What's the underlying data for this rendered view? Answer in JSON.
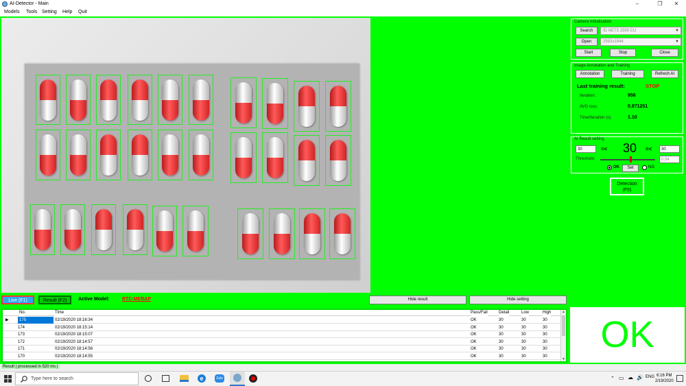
{
  "window": {
    "title": "AI-Detector - Main"
  },
  "menu": [
    "Models",
    "Tools",
    "Setting",
    "Help",
    "Quit"
  ],
  "camera_init": {
    "title": "Camera Initialization",
    "search_label": "Search",
    "camera_value": "ID NET3 1500 CU",
    "open_label": "Open",
    "resolution_value": "2592x1944",
    "start_label": "Start",
    "stop_label": "Stop",
    "close_label": "Close"
  },
  "training": {
    "title": "Image Annotation and Training",
    "annotation_label": "Annotation",
    "training_label": "Training",
    "refresh_label": "Refresh AI",
    "last_result_label": "Last training result:",
    "last_result_value": "STOP",
    "iteration_label": "Iteration:",
    "iteration_value": "956",
    "avg_loss_label": "AVG loss:",
    "avg_loss_value": "0.871251",
    "time_label": "Time/Iteration (s):",
    "time_value": "1.10"
  },
  "ai_result": {
    "title": "AI Result setting",
    "low_value": "30",
    "op_left": "=<",
    "count_value": "30",
    "op_right": "=<",
    "high_value": "30",
    "threshold_label": "Threshold:",
    "threshold_value": "0.54",
    "ok_label": "OK",
    "set_label": "Set",
    "ng_label": "NG"
  },
  "detection": {
    "line1": "Detection",
    "line2": "(F5)"
  },
  "tabs": {
    "live_label": "Live (F1)",
    "result_label": "Result (F2)",
    "active_model_label": "Active Model:",
    "active_model_value": "RTC-MERAP",
    "hide_result_label": "Hide result",
    "hide_setting_label": "Hide setting"
  },
  "grid": {
    "columns": [
      "No.",
      "Time",
      "Pass/Fail",
      "Detail",
      "Low",
      "High"
    ],
    "rows": [
      {
        "no": "175",
        "time": "02/19/2020 18:16:34",
        "pf": "OK",
        "detail": "30",
        "low": "30",
        "high": "30"
      },
      {
        "no": "174",
        "time": "02/19/2020 18:15:14",
        "pf": "OK",
        "detail": "30",
        "low": "30",
        "high": "30"
      },
      {
        "no": "173",
        "time": "02/19/2020 18:15:07",
        "pf": "OK",
        "detail": "30",
        "low": "30",
        "high": "30"
      },
      {
        "no": "172",
        "time": "02/19/2020 18:14:57",
        "pf": "OK",
        "detail": "30",
        "low": "30",
        "high": "30"
      },
      {
        "no": "171",
        "time": "02/19/2020 18:14:56",
        "pf": "OK",
        "detail": "30",
        "low": "30",
        "high": "30"
      },
      {
        "no": "170",
        "time": "02/19/2020 18:14:55",
        "pf": "OK",
        "detail": "30",
        "low": "30",
        "high": "30"
      }
    ]
  },
  "result_display": "OK",
  "status": "Result | processed in 520 ms |",
  "taskbar": {
    "search_placeholder": "Type here to search",
    "time": "6:16 PM",
    "date": "2/19/2020",
    "icons": [
      "windows-start-icon",
      "search-icon",
      "task-view-icon",
      "file-explorer-icon",
      "edge-icon",
      "app-icon",
      "ai-detector-icon",
      "record-icon"
    ]
  },
  "colors": {
    "app_background": "#00ff00",
    "detection_box": "#22ee22",
    "stop_text": "#ff0000",
    "model_text": "#ff0000",
    "ok_text": "#00ff00",
    "live_tab": "#2aa9f0"
  }
}
